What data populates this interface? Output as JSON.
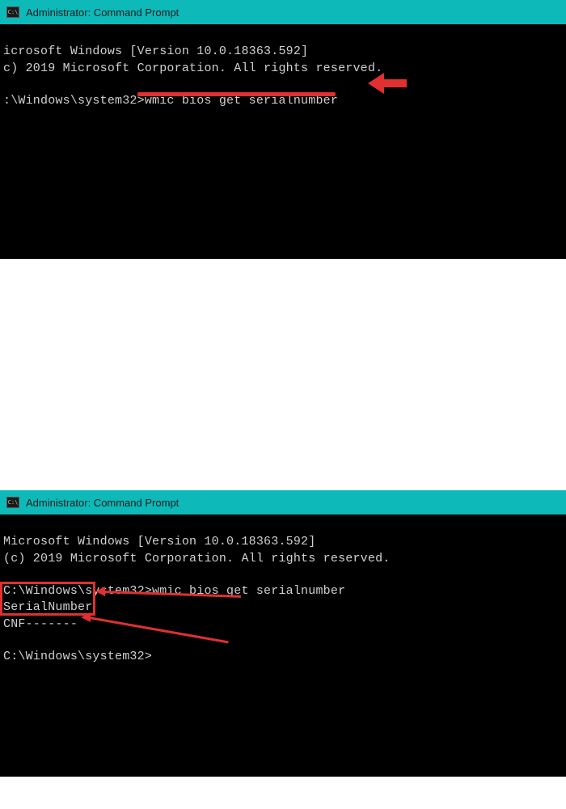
{
  "window1": {
    "title": "Administrator: Command Prompt",
    "line1": "icrosoft Windows [Version 10.0.18363.592]",
    "line2": "c) 2019 Microsoft Corporation. All rights reserved.",
    "prompt_path": ":\\Windows\\system32>",
    "command": "wmic bios get serialnumber",
    "annotations": {
      "underline": true,
      "arrow_pointing_to_command": true,
      "accent_color": "#e03030"
    }
  },
  "window2": {
    "title": "Administrator: Command Prompt",
    "line1": "Microsoft Windows [Version 10.0.18363.592]",
    "line2": "(c) 2019 Microsoft Corporation. All rights reserved.",
    "prompt_path": "C:\\Windows\\system32>",
    "command": "wmic bios get serialnumber",
    "output_header": "SerialNumber",
    "output_value": "CNF-------",
    "prompt_path2": "C:\\Windows\\system32>",
    "annotations": {
      "box_around_output": true,
      "arrows_pointing_to_output": true,
      "accent_color": "#e03030"
    }
  }
}
